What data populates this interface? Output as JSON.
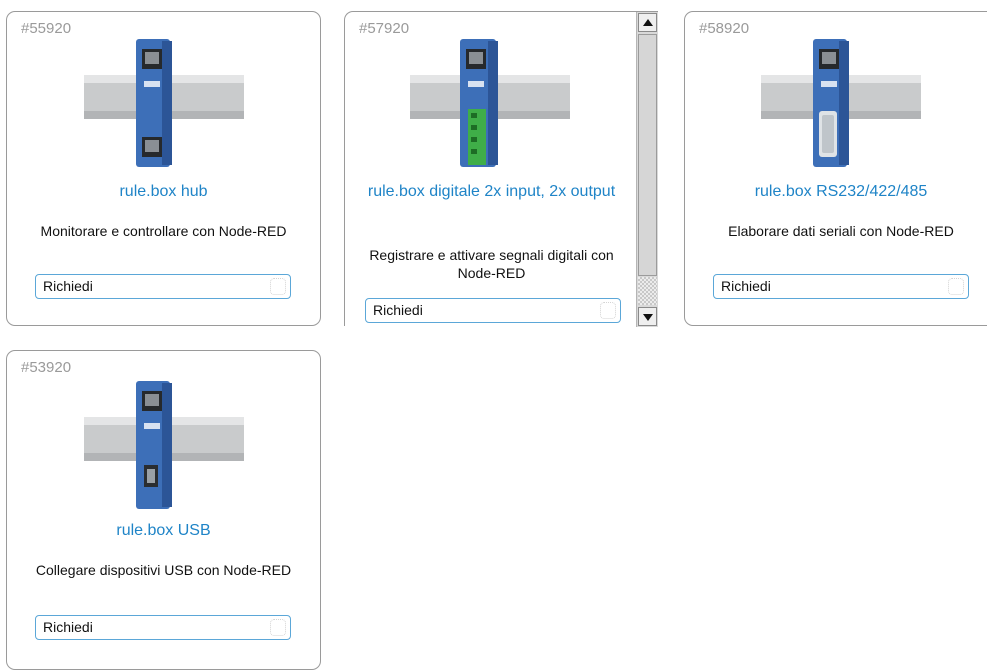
{
  "cards": [
    {
      "sku": "#55920",
      "title": "rule.box hub",
      "description": "Monitorare e controllare con Node-RED",
      "button_label": "Richiedi",
      "image": "din-rail-device-two-ethernet-ports-icon"
    },
    {
      "sku": "#57920",
      "title": "rule.box digitale 2x input, 2x output",
      "description": "Registrare e attivare segnali digitali con Node-RED",
      "button_label": "Richiedi",
      "image": "din-rail-device-green-terminal-block-icon"
    },
    {
      "sku": "#58920",
      "title": "rule.box RS232/422/485",
      "description": "Elaborare dati seriali con Node-RED",
      "button_label": "Richiedi",
      "image": "din-rail-device-serial-connector-icon"
    },
    {
      "sku": "#53920",
      "title": "rule.box USB",
      "description": "Collegare dispositivi USB con Node-RED",
      "button_label": "Richiedi",
      "image": "din-rail-device-usb-port-icon"
    }
  ],
  "colors": {
    "title_link": "#1f84c7",
    "sku_gray": "#9a9a9a",
    "button_border": "#5ba7d8",
    "device_blue": "#3d6fb8",
    "terminal_green": "#3fae48"
  }
}
